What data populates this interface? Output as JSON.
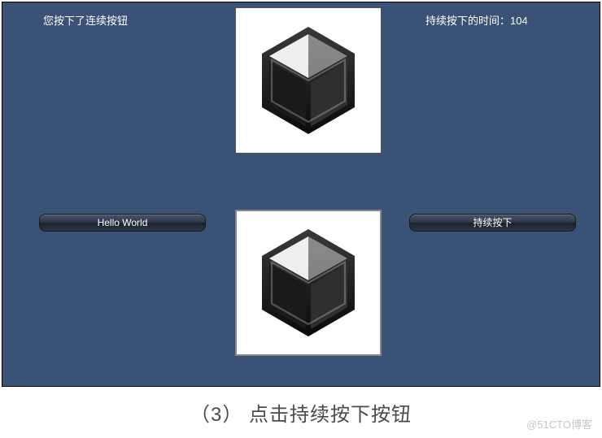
{
  "status": {
    "left_text": "您按下了连续按钮",
    "right_label": "持续按下的时间：",
    "right_value": "104"
  },
  "buttons": {
    "left_label": "Hello World",
    "right_label": "持续按下"
  },
  "icons": {
    "top": "unity-logo-icon",
    "bottom": "unity-logo-icon"
  },
  "caption": "（3） 点击持续按下按钮",
  "watermark": "@51CTO博客",
  "colors": {
    "background": "#3a5276",
    "text": "#ffffff"
  }
}
